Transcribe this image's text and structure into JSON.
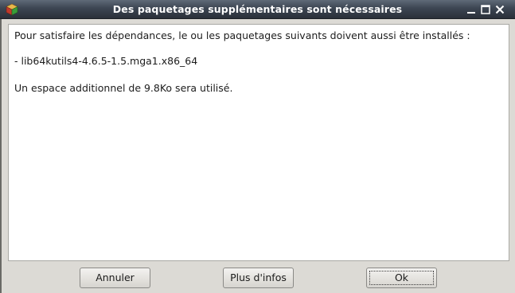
{
  "window": {
    "title": "Des paquetages supplémentaires sont nécessaires",
    "icon": "package-icon",
    "controls": {
      "minimize_icon": "minimize-icon",
      "maximize_icon": "maximize-icon",
      "close_icon": "close-icon"
    }
  },
  "message": {
    "line1": "Pour satisfaire les dépendances, le ou les paquetages suivants doivent aussi être installés :",
    "line2": "- lib64kutils4-4.6.5-1.5.mga1.x86_64",
    "line3": "Un espace additionnel de 9.8Ko sera utilisé."
  },
  "buttons": {
    "cancel_label": "Annuler",
    "info_label": "Plus d'infos",
    "ok_label": "Ok"
  },
  "colors": {
    "titlebar": "#3c4552",
    "title_text": "#ffffff",
    "content_bg": "#ffffff",
    "window_bg": "#dcdad5"
  }
}
